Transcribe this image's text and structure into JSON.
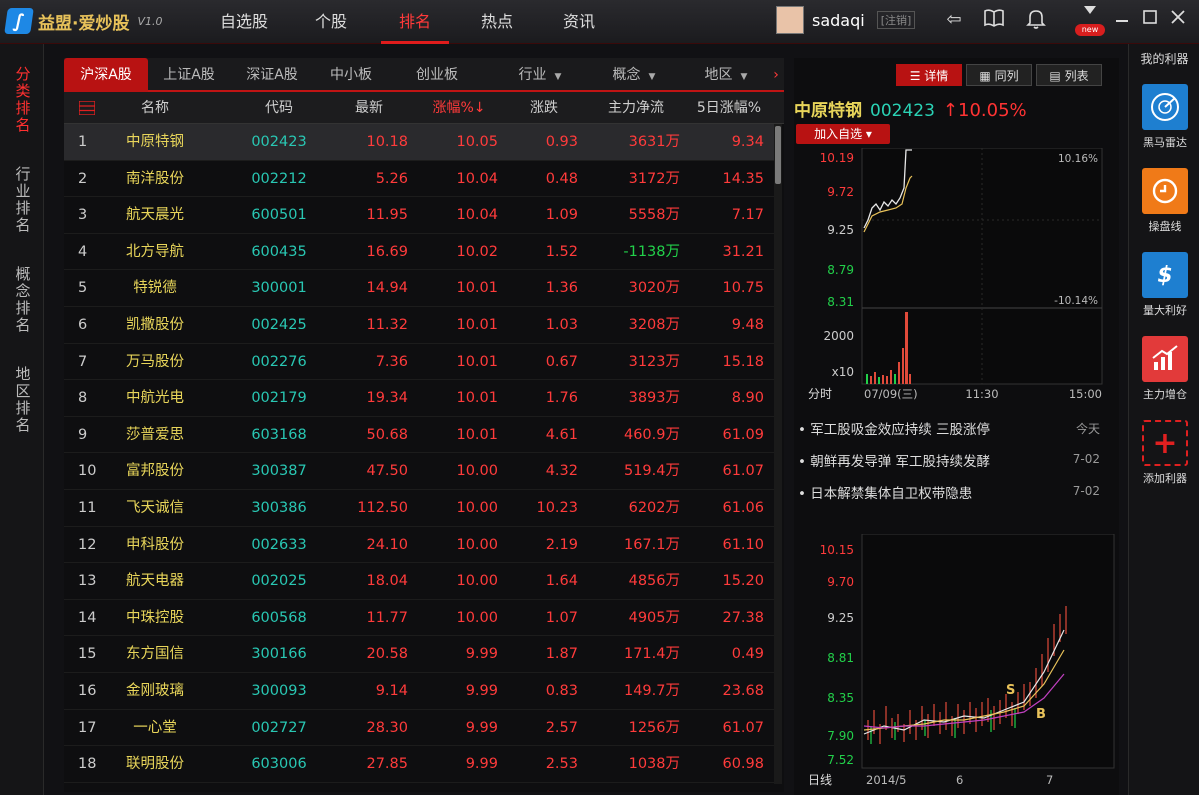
{
  "app": {
    "title": "益盟·爱炒股",
    "version": "V1.0"
  },
  "nav": [
    {
      "label": "自选股",
      "active": false
    },
    {
      "label": "个股",
      "active": false
    },
    {
      "label": "排名",
      "active": true
    },
    {
      "label": "热点",
      "active": false
    },
    {
      "label": "资讯",
      "active": false
    }
  ],
  "user": {
    "name": "sadaqi",
    "logout": "[注销]",
    "badge": "new"
  },
  "left_rail": [
    {
      "label": "分类排名",
      "active": true
    },
    {
      "label": "行业排名",
      "active": false
    },
    {
      "label": "概念排名",
      "active": false
    },
    {
      "label": "地区排名",
      "active": false
    }
  ],
  "tabs": [
    {
      "label": "沪深A股",
      "active": true,
      "dropdown": false
    },
    {
      "label": "上证A股",
      "active": false,
      "dropdown": false
    },
    {
      "label": "深证A股",
      "active": false,
      "dropdown": false
    },
    {
      "label": "中小板",
      "active": false,
      "dropdown": false
    },
    {
      "label": "创业板",
      "active": false,
      "dropdown": false
    },
    {
      "label": "行业",
      "active": false,
      "dropdown": true
    },
    {
      "label": "概念",
      "active": false,
      "dropdown": true
    },
    {
      "label": "地区",
      "active": false,
      "dropdown": true
    }
  ],
  "table": {
    "columns": [
      "名称",
      "代码",
      "最新",
      "涨幅%↓",
      "涨跌",
      "主力净流",
      "5日涨幅%"
    ],
    "rows": [
      [
        "1",
        "中原特钢",
        "002423",
        "10.18",
        "10.05",
        "0.93",
        "3631万",
        "9.34"
      ],
      [
        "2",
        "南洋股份",
        "002212",
        "5.26",
        "10.04",
        "0.48",
        "3172万",
        "14.35"
      ],
      [
        "3",
        "航天晨光",
        "600501",
        "11.95",
        "10.04",
        "1.09",
        "5558万",
        "7.17"
      ],
      [
        "4",
        "北方导航",
        "600435",
        "16.69",
        "10.02",
        "1.52",
        "-1138万",
        "31.21"
      ],
      [
        "5",
        "特锐德",
        "300001",
        "14.94",
        "10.01",
        "1.36",
        "3020万",
        "10.75"
      ],
      [
        "6",
        "凯撒股份",
        "002425",
        "11.32",
        "10.01",
        "1.03",
        "3208万",
        "9.48"
      ],
      [
        "7",
        "万马股份",
        "002276",
        "7.36",
        "10.01",
        "0.67",
        "3123万",
        "15.18"
      ],
      [
        "8",
        "中航光电",
        "002179",
        "19.34",
        "10.01",
        "1.76",
        "3893万",
        "8.90"
      ],
      [
        "9",
        "莎普爱思",
        "603168",
        "50.68",
        "10.01",
        "4.61",
        "460.9万",
        "61.09"
      ],
      [
        "10",
        "富邦股份",
        "300387",
        "47.50",
        "10.00",
        "4.32",
        "519.4万",
        "61.07"
      ],
      [
        "11",
        "飞天诚信",
        "300386",
        "112.50",
        "10.00",
        "10.23",
        "6202万",
        "61.06"
      ],
      [
        "12",
        "申科股份",
        "002633",
        "24.10",
        "10.00",
        "2.19",
        "167.1万",
        "61.10"
      ],
      [
        "13",
        "航天电器",
        "002025",
        "18.04",
        "10.00",
        "1.64",
        "4856万",
        "15.20"
      ],
      [
        "14",
        "中珠控股",
        "600568",
        "11.77",
        "10.00",
        "1.07",
        "4905万",
        "27.38"
      ],
      [
        "15",
        "东方国信",
        "300166",
        "20.58",
        "9.99",
        "1.87",
        "171.4万",
        "0.49"
      ],
      [
        "16",
        "金刚玻璃",
        "300093",
        "9.14",
        "9.99",
        "0.83",
        "149.7万",
        "23.68"
      ],
      [
        "17",
        "一心堂",
        "002727",
        "28.30",
        "9.99",
        "2.57",
        "1256万",
        "61.07"
      ],
      [
        "18",
        "联明股份",
        "603006",
        "27.85",
        "9.99",
        "2.53",
        "1038万",
        "60.98"
      ]
    ]
  },
  "detail": {
    "view_buttons": [
      {
        "label": "详情",
        "active": true
      },
      {
        "label": "同列",
        "active": false
      },
      {
        "label": "列表",
        "active": false
      }
    ],
    "stock": {
      "name": "中原特钢",
      "code": "002423",
      "change": "↑10.05%"
    },
    "add_button": "加入自选 ▾",
    "intraday": {
      "price_ticks": [
        "10.19",
        "9.72",
        "9.25",
        "8.79",
        "8.31"
      ],
      "pct_high": "10.16%",
      "pct_low": "-10.14%",
      "vol_tick": "2000",
      "vol_unit": "x10",
      "label": "分时",
      "date": "07/09(三)",
      "time_mid": "11:30",
      "time_end": "15:00"
    },
    "news": [
      {
        "title": "军工股吸金效应持续 三股涨停",
        "date": "今天"
      },
      {
        "title": "朝鲜再发导弹 军工股持续发酵",
        "date": "7-02"
      },
      {
        "title": "日本解禁集体自卫权带隐患",
        "date": "7-02"
      }
    ],
    "daily": {
      "price_ticks": [
        "10.15",
        "9.70",
        "9.25",
        "8.81",
        "8.35",
        "7.90",
        "7.52"
      ],
      "label": "日线",
      "x_ticks": [
        "2014/5",
        "6",
        "7"
      ],
      "marks": [
        "S",
        "B"
      ]
    }
  },
  "right_rail": {
    "title": "我的利器",
    "tools": [
      {
        "label": "黑马雷达",
        "icon": "radar-icon",
        "color": "#1e7fd0"
      },
      {
        "label": "操盘线",
        "icon": "trading-line-icon",
        "color": "#f07a18"
      },
      {
        "label": "量大利好",
        "icon": "volume-icon",
        "color": "#1e7fd0"
      },
      {
        "label": "主力增仓",
        "icon": "capital-inflow-icon",
        "color": "#e23a3a"
      },
      {
        "label": "添加利器",
        "icon": "add-icon",
        "color": "#e02020"
      }
    ]
  },
  "colors": {
    "accent": "#b81212",
    "up": "#ff3b3b",
    "down": "#22d04a",
    "name": "#e8d55a",
    "code": "#29c7b3"
  }
}
